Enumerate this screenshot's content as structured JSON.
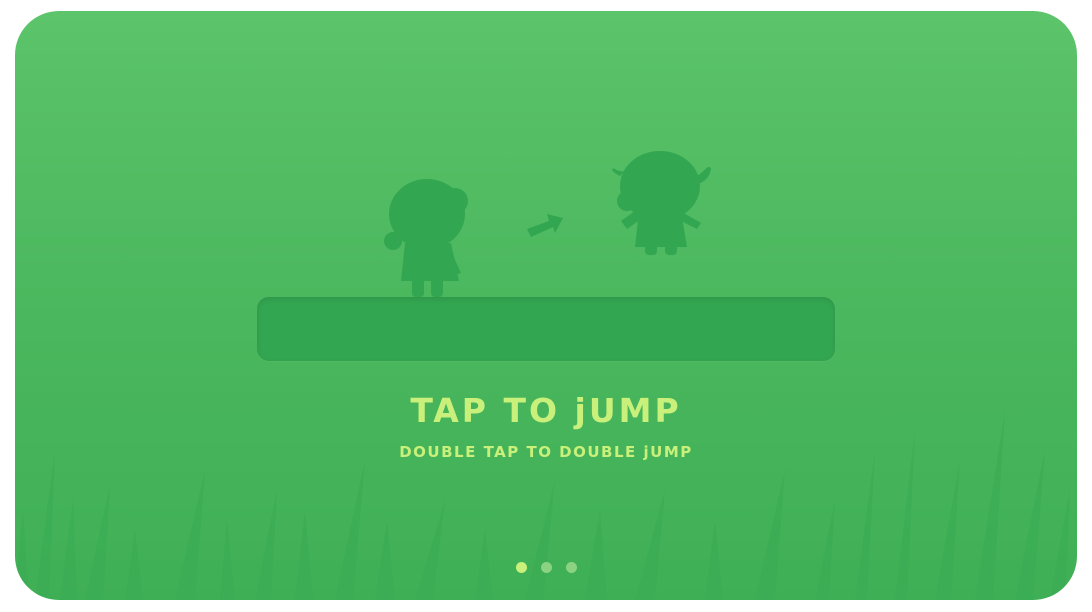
{
  "tutorial": {
    "title": "TAP TO jUMP",
    "subtitle": "DOUBLE TAP TO DOUBLE jUMP",
    "page_count": 3,
    "active_page": 1
  },
  "colors": {
    "background": "#4cb85f",
    "silhouette": "#33a651",
    "text": "#c8f07a",
    "dot_active": "#c8f07a",
    "dot_inactive": "#8bd283"
  },
  "icons": {
    "character_standing": "character-standing-icon",
    "arrow": "arrow-icon",
    "character_jumping": "character-jumping-icon"
  }
}
